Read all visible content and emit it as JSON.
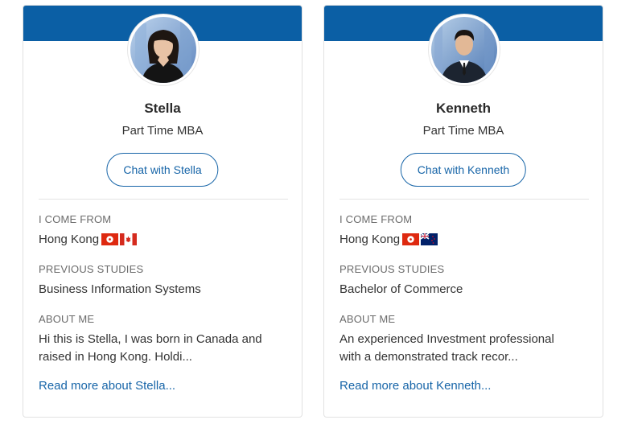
{
  "colors": {
    "header": "#0b5fa5",
    "link": "#1765a8",
    "border": "#e1e1e1"
  },
  "cards": [
    {
      "name": "Stella",
      "program": "Part Time MBA",
      "chat_label": "Chat with Stella",
      "from_label": "I COME FROM",
      "from_value": "Hong Kong",
      "flags": [
        "hong-kong-flag-icon",
        "canada-flag-icon"
      ],
      "studies_label": "PREVIOUS STUDIES",
      "studies_value": "Business Information Systems",
      "about_label": "ABOUT ME",
      "about_line1": "Hi this is Stella, I was born in Canada and",
      "about_line2": "raised in Hong Kong. Holdi...",
      "read_more": "Read more about Stella..."
    },
    {
      "name": "Kenneth",
      "program": "Part Time MBA",
      "chat_label": "Chat with Kenneth",
      "from_label": "I COME FROM",
      "from_value": "Hong Kong",
      "flags": [
        "hong-kong-flag-icon",
        "new-zealand-flag-icon"
      ],
      "studies_label": "PREVIOUS STUDIES",
      "studies_value": "Bachelor of Commerce",
      "about_label": "ABOUT ME",
      "about_line1": "An experienced Investment professional",
      "about_line2": "with a demonstrated track recor...",
      "read_more": "Read more about Kenneth..."
    }
  ]
}
